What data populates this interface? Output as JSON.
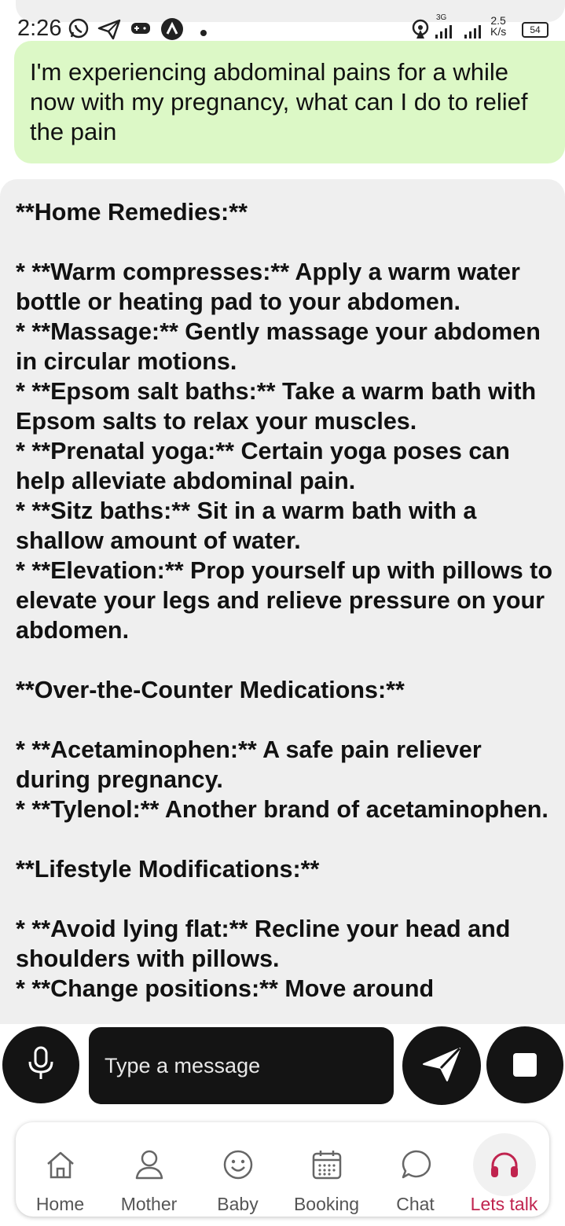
{
  "status_bar": {
    "time": "2:26",
    "net_speed": "2.5",
    "net_speed_unit": "K/s",
    "network_type": "3G",
    "battery": "54",
    "icons": [
      "whatsapp-icon",
      "telegram-icon",
      "game-controller-icon",
      "app-a-icon",
      "dot-icon",
      "hotspot-icon",
      "signal-icon",
      "signal-icon",
      "battery-icon"
    ]
  },
  "chat": {
    "user_message": "I'm experiencing abdominal pains for a while now with my pregnancy, what can I do to relief the pain",
    "bot_message": "**Home Remedies:**\n\n* **Warm compresses:** Apply a warm water bottle or heating pad to your abdomen.\n* **Massage:** Gently massage your abdomen in circular motions.\n* **Epsom salt baths:** Take a warm bath with Epsom salts to relax your muscles.\n* **Prenatal yoga:** Certain yoga poses can help alleviate abdominal pain.\n* **Sitz baths:** Sit in a warm bath with a shallow amount of water.\n* **Elevation:** Prop yourself up with pillows to elevate your legs and relieve pressure on your abdomen.\n\n**Over-the-Counter Medications:**\n\n* **Acetaminophen:** A safe pain reliever during pregnancy.\n* **Tylenol:** Another brand of acetaminophen.\n\n**Lifestyle Modifications:**\n\n* **Avoid lying flat:** Recline your head and shoulders with pillows.\n* **Change positions:** Move around",
    "user_bubble_color": "#dcf8c6",
    "bot_bubble_color": "#efefef"
  },
  "composer": {
    "placeholder": "Type a message",
    "icons": [
      "microphone-icon",
      "send-icon",
      "stop-icon"
    ]
  },
  "bottom_nav": {
    "items": [
      {
        "label": "Home",
        "icon": "home-icon"
      },
      {
        "label": "Mother",
        "icon": "person-icon"
      },
      {
        "label": "Baby",
        "icon": "smiley-icon"
      },
      {
        "label": "Booking",
        "icon": "calendar-icon"
      },
      {
        "label": "Chat",
        "icon": "chat-bubble-icon"
      },
      {
        "label": "Lets talk",
        "icon": "headphones-icon",
        "active": true
      }
    ],
    "active_color": "#c0244f",
    "inactive_color": "#555555"
  }
}
